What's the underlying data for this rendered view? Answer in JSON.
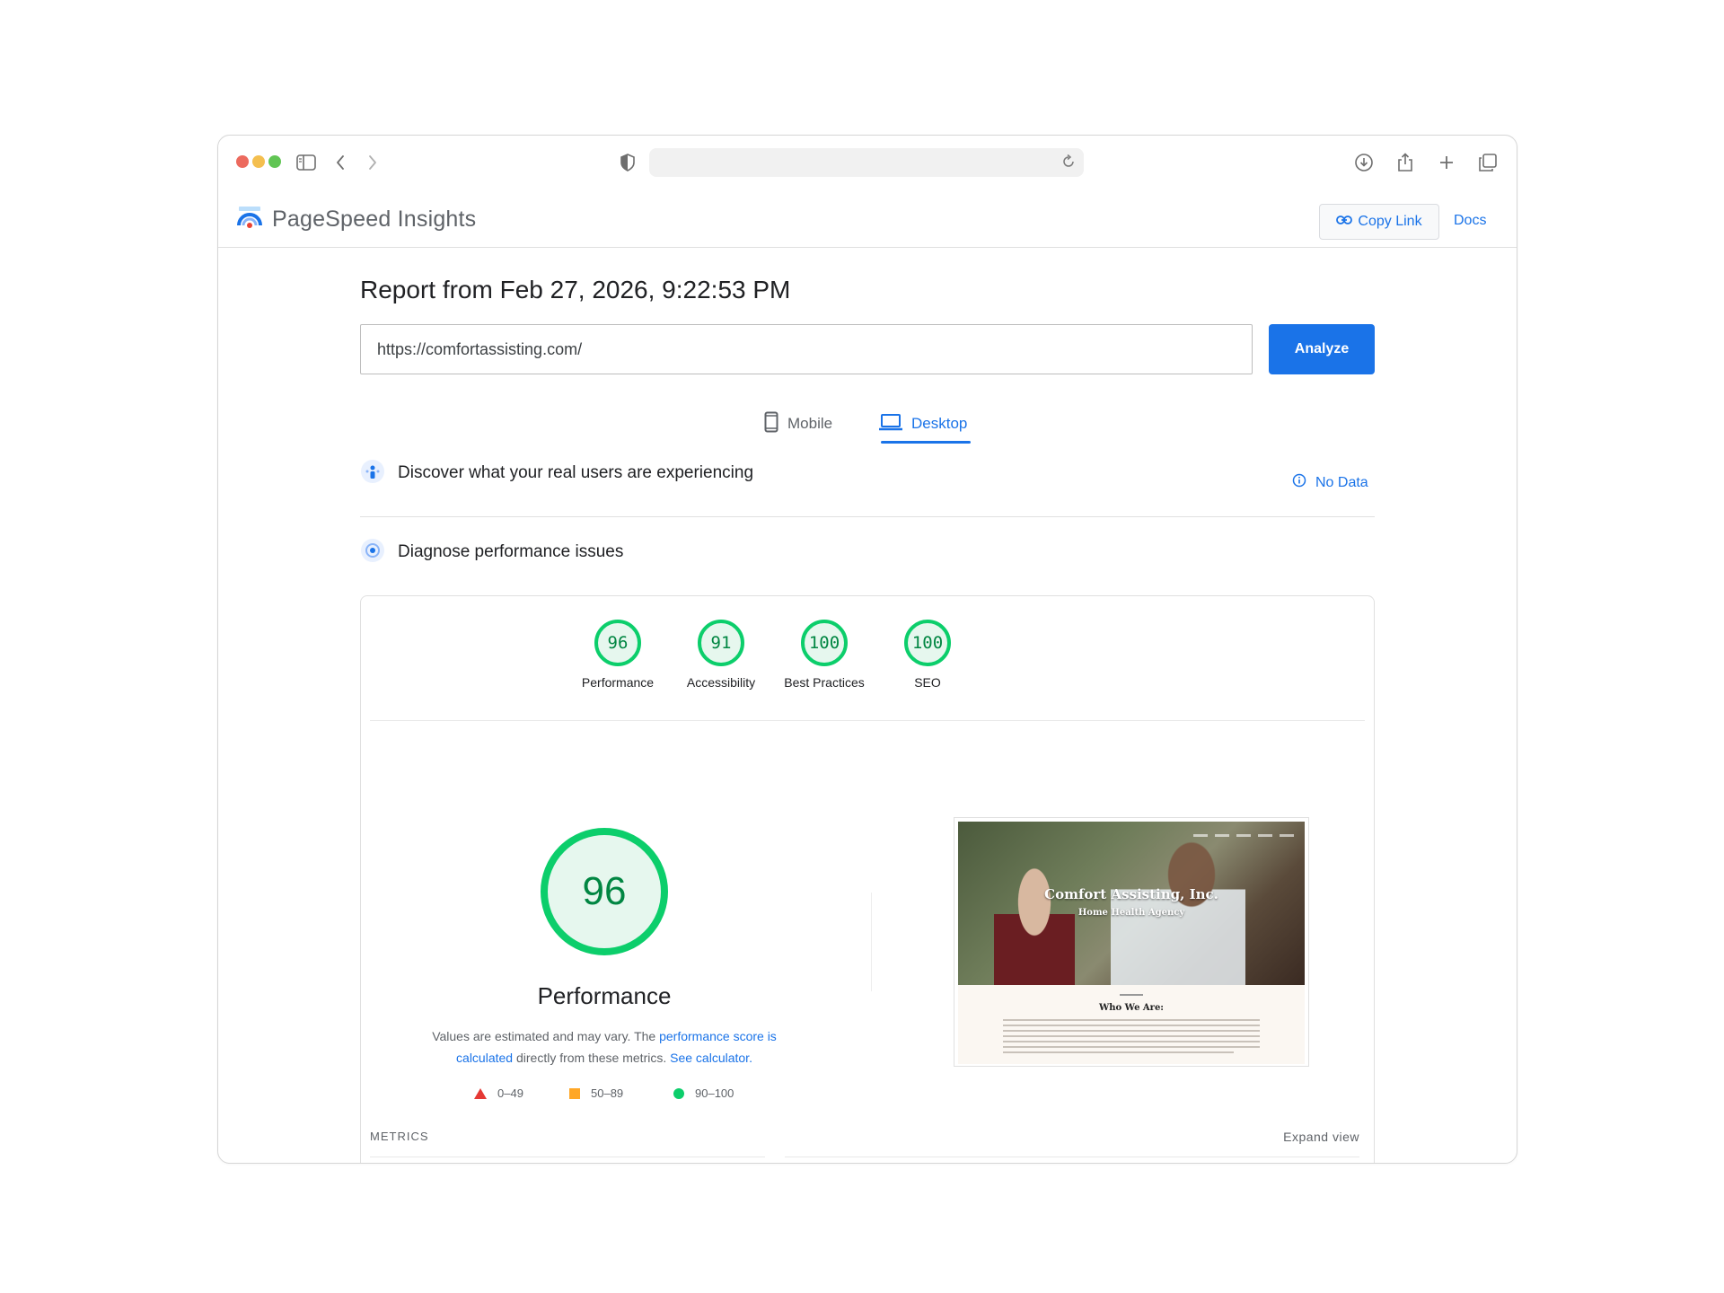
{
  "app": {
    "title": "PageSpeed Insights",
    "copy_link_label": "Copy Link",
    "docs_label": "Docs"
  },
  "browser": {
    "address": ""
  },
  "report": {
    "title": "Report from Feb 27, 2026, 9:22:53 PM",
    "url_value": "https://comfortassisting.com/",
    "analyze_label": "Analyze"
  },
  "tabs": [
    {
      "label": "Mobile",
      "icon": "phone-icon",
      "selected": false
    },
    {
      "label": "Desktop",
      "icon": "laptop-icon",
      "selected": true
    }
  ],
  "field_section": {
    "title": "Discover what your real users are experiencing",
    "status": "No Data"
  },
  "lab_section": {
    "title": "Diagnose performance issues"
  },
  "scores": [
    {
      "label": "Performance",
      "value": "96"
    },
    {
      "label": "Accessibility",
      "value": "91"
    },
    {
      "label": "Best Practices",
      "value": "100"
    },
    {
      "label": "SEO",
      "value": "100"
    }
  ],
  "performance_detail": {
    "score": "96",
    "label": "Performance",
    "note_prefix": "Values are estimated and may vary. The ",
    "note_link1": "performance score is calculated",
    "note_mid": " directly from these metrics. ",
    "note_link2": "See calculator.",
    "legend": [
      {
        "range": "0–49",
        "shape": "triangle",
        "color": "#e53935"
      },
      {
        "range": "50–89",
        "shape": "square",
        "color": "#ffa726"
      },
      {
        "range": "90–100",
        "shape": "circle",
        "color": "#0cce6b"
      }
    ]
  },
  "screenshot": {
    "title": "Comfort Assisting, Inc.",
    "subtitle": "Home Health Agency",
    "who_heading": "Who We Are:"
  },
  "metrics": {
    "label": "METRICS",
    "expand_label": "Expand view"
  },
  "colors": {
    "accent": "#1a73e8",
    "pass": "#0cce6b",
    "pass_text": "#018642"
  }
}
